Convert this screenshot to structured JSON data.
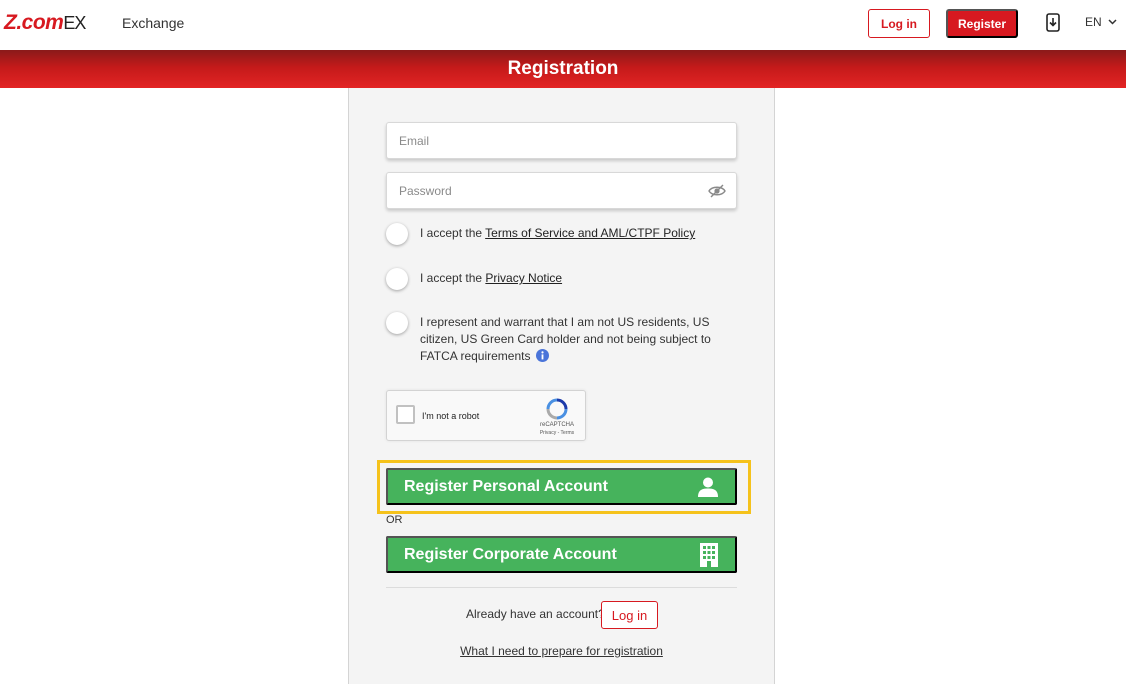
{
  "header": {
    "logo_text": "Z.com",
    "logo_suffix": "EX",
    "nav_exchange": "Exchange",
    "login_label": "Log in",
    "register_label": "Register",
    "download_icon": "download-app-icon",
    "language": "EN"
  },
  "banner": {
    "title": "Registration"
  },
  "form": {
    "email_placeholder": "Email",
    "password_placeholder": "Password",
    "terms_prefix": "I accept the ",
    "terms_link": "Terms of Service and AML/CTPF Policy",
    "privacy_prefix": "I accept the ",
    "privacy_link": "Privacy Notice",
    "fatca_text": "I represent and warrant that I am not US residents, US citizen, US Green Card holder and not being subject to FATCA requirements",
    "captcha": {
      "label": "I'm not a robot",
      "brand": "reCAPTCHA",
      "links": "Privacy - Terms"
    },
    "register_personal": "Register Personal Account",
    "or_label": "OR",
    "register_corporate": "Register Corporate Account",
    "already_text": "Already have an account?",
    "login_label": "Log in",
    "prepare_link": "What I need to prepare for registration"
  },
  "colors": {
    "brand_red": "#d71920",
    "green": "#46b35c",
    "highlight": "#f5c21b"
  }
}
